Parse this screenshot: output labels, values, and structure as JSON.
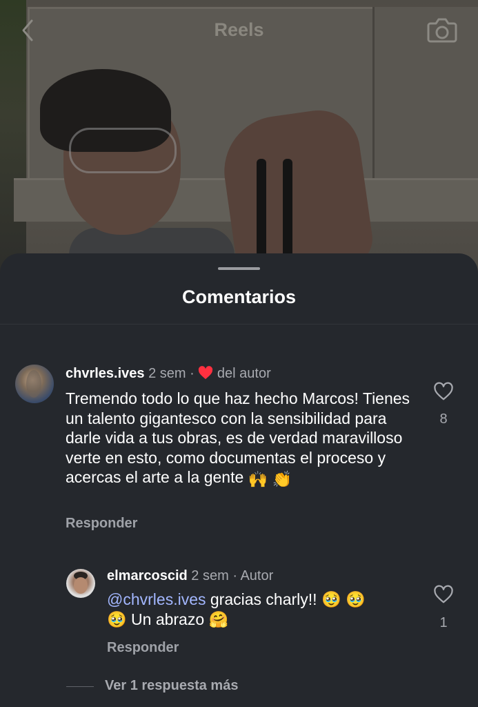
{
  "header": {
    "title": "Reels",
    "back_icon": "chevron-left-icon",
    "camera_icon": "camera-icon"
  },
  "sheet": {
    "title": "Comentarios"
  },
  "comments": [
    {
      "username": "chvrles.ives",
      "time": "2 sem",
      "separator": "·",
      "liked_by_author_label": "del autor",
      "text": "Tremendo todo lo que haz hecho Marcos! Tienes un talento gigantesco con la sensibilidad para darle vida a tus obras, es de verdad maravilloso verte en esto, como documentas el proceso y acercas el arte a la gente",
      "emojis": "🙌 👏",
      "reply_label": "Responder",
      "like_count": "8"
    },
    {
      "username": "elmarcoscid",
      "time": "2 sem",
      "separator": "·",
      "author_label": "Autor",
      "mention": "@chvrles.ives",
      "text_part1": "gracias charly!! 🥹 🥹",
      "text_part2": "🥹 Un abrazo 🤗",
      "reply_label": "Responder",
      "like_count": "1"
    }
  ],
  "more_replies_label": "Ver 1 respuesta más",
  "colors": {
    "sheet_bg": "#25282d",
    "heart_red": "#ff3040",
    "mention": "#a3b7ff"
  }
}
